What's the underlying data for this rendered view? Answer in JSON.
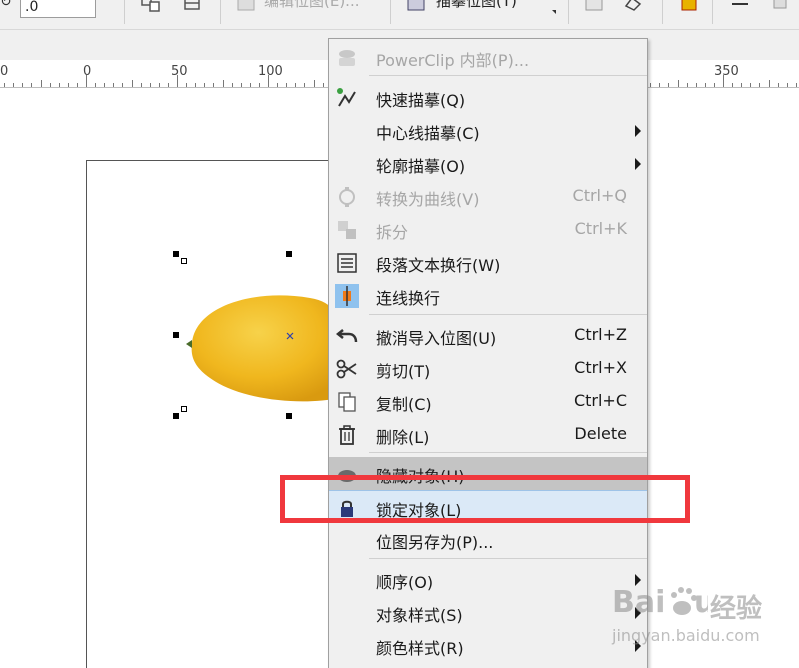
{
  "toolbar": {
    "rotation_value": ".0",
    "edit_bitmap_label": "编辑位图(E)...",
    "trace_bitmap_label": "描摹位图(T)"
  },
  "ruler": {
    "labels": [
      "0",
      "0",
      "50",
      "100",
      "350"
    ]
  },
  "menu": {
    "items": [
      {
        "label": "PowerClip 内部(P)...",
        "shortcut": "",
        "disabled": true,
        "submenu": false,
        "icon": "powerclip-icon"
      },
      {
        "label": "快速描摹(Q)",
        "shortcut": "",
        "disabled": false,
        "submenu": false,
        "icon": "quick-trace-icon"
      },
      {
        "label": "中心线描摹(C)",
        "shortcut": "",
        "disabled": false,
        "submenu": true,
        "icon": ""
      },
      {
        "label": "轮廓描摹(O)",
        "shortcut": "",
        "disabled": false,
        "submenu": true,
        "icon": ""
      },
      {
        "label": "转换为曲线(V)",
        "shortcut": "Ctrl+Q",
        "disabled": true,
        "submenu": false,
        "icon": "convert-curves-icon"
      },
      {
        "label": "拆分",
        "shortcut": "Ctrl+K",
        "disabled": true,
        "submenu": false,
        "icon": "break-apart-icon"
      },
      {
        "label": "段落文本换行(W)",
        "shortcut": "",
        "disabled": false,
        "submenu": false,
        "icon": "text-wrap-icon"
      },
      {
        "label": "连线换行",
        "shortcut": "",
        "disabled": false,
        "submenu": false,
        "icon": "line-wrap-icon"
      },
      {
        "label": "撤消导入位图(U)",
        "shortcut": "Ctrl+Z",
        "disabled": false,
        "submenu": false,
        "icon": "undo-icon"
      },
      {
        "label": "剪切(T)",
        "shortcut": "Ctrl+X",
        "disabled": false,
        "submenu": false,
        "icon": "scissors-icon"
      },
      {
        "label": "复制(C)",
        "shortcut": "Ctrl+C",
        "disabled": false,
        "submenu": false,
        "icon": "copy-icon"
      },
      {
        "label": "删除(L)",
        "shortcut": "Delete",
        "disabled": false,
        "submenu": false,
        "icon": "trash-icon"
      },
      {
        "label": "隐藏对象(H)",
        "shortcut": "",
        "disabled": false,
        "submenu": false,
        "icon": "hide-icon"
      },
      {
        "label": "锁定对象(L)",
        "shortcut": "",
        "disabled": false,
        "submenu": false,
        "icon": "lock-icon"
      },
      {
        "label": "位图另存为(P)...",
        "shortcut": "",
        "disabled": false,
        "submenu": false,
        "icon": ""
      },
      {
        "label": "顺序(O)",
        "shortcut": "",
        "disabled": false,
        "submenu": true,
        "icon": ""
      },
      {
        "label": "对象样式(S)",
        "shortcut": "",
        "disabled": false,
        "submenu": true,
        "icon": ""
      },
      {
        "label": "颜色样式(R)",
        "shortcut": "",
        "disabled": false,
        "submenu": true,
        "icon": ""
      }
    ]
  },
  "watermark": {
    "text": "经验",
    "url": "jingyan.baidu.com"
  },
  "colors": {
    "highlight": "#f0383d",
    "selected_item": "#dbe9f7",
    "mango": "#f0b71e"
  }
}
